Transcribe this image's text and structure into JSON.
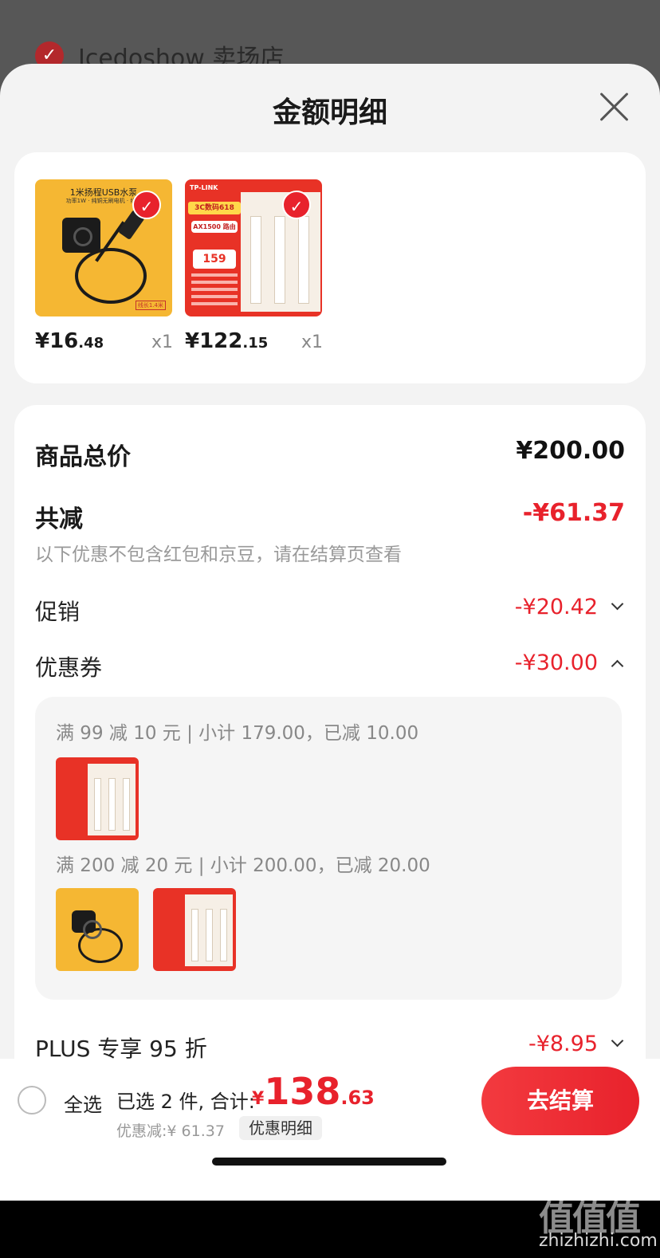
{
  "background_store": {
    "name": "Icedoshow 卖场店"
  },
  "sheet": {
    "title": "金额明细"
  },
  "products": [
    {
      "price_int": "¥16",
      "price_dec": ".48",
      "qty": "x1",
      "thumb": {
        "title": "1米扬程USB水泵",
        "sub": "功率1W · 纯铜无刷电机 · 线长",
        "tag": "线长1.4米"
      }
    },
    {
      "price_int": "¥122",
      "price_dec": ".15",
      "qty": "x1",
      "thumb": {
        "brand": "TP-LINK",
        "promo": "3C数码618",
        "spec": "AX1500 路由",
        "number": "159"
      }
    }
  ],
  "summary": {
    "subtotal_label": "商品总价",
    "subtotal_amount": "¥200.00",
    "reduction_label": "共减",
    "reduction_amount": "-¥61.37",
    "note": "以下优惠不包含红包和京豆，请在结算页查看",
    "promo_label": "促销",
    "promo_amount": "-¥20.42",
    "coupon_label": "优惠券",
    "coupon_amount": "-¥30.00",
    "coupon_lines": [
      "满 99 减 10 元 | 小计 179.00，已减 10.00",
      "满 200 减 20 元 | 小计 200.00，已减 20.00"
    ],
    "plus_label": "PLUS 专享 95 折",
    "plus_amount": "-¥8.95"
  },
  "bottom": {
    "select_all": "全选",
    "selected_text": "已选 2 件, 合计:",
    "total_currency": "¥",
    "total_int": "138",
    "total_dec": ".63",
    "discount_text": "优惠减:¥ 61.37",
    "detail_button": "优惠明细",
    "checkout_button": "去结算"
  },
  "watermark": {
    "logo": "值值值",
    "url": "zhizhizhi.com"
  },
  "colors": {
    "accent_red": "#e8222c",
    "sheet_bg": "#f3f3f3"
  }
}
